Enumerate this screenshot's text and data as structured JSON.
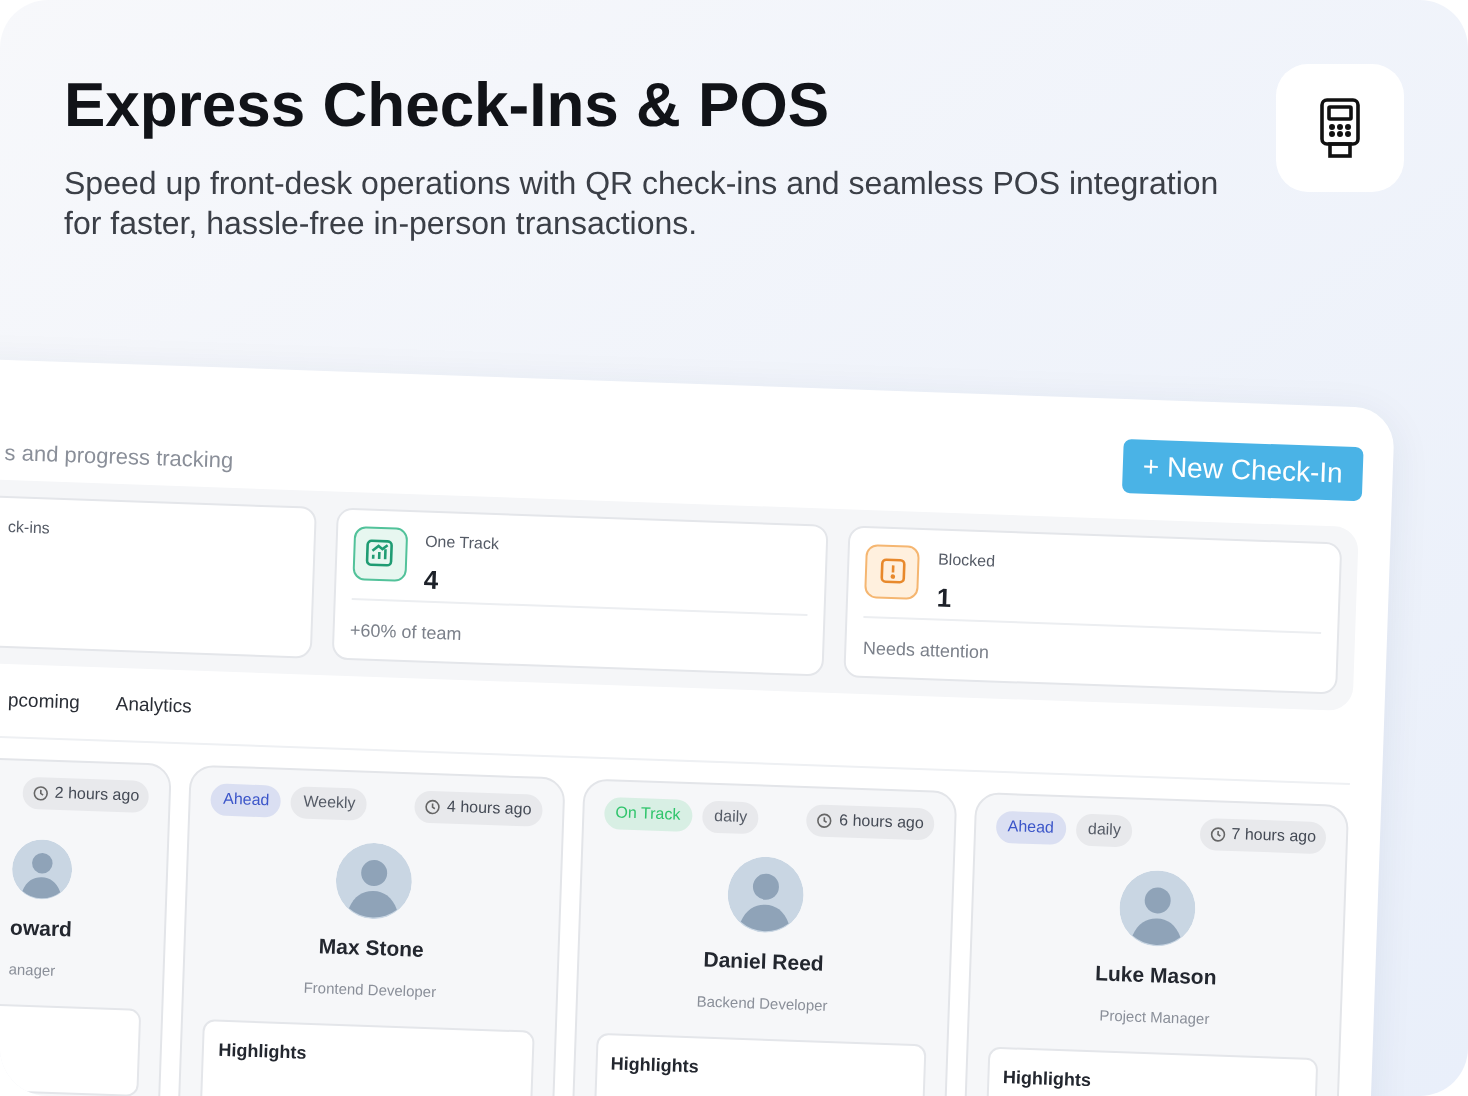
{
  "header": {
    "title": "Express Check-Ins & POS",
    "description": "Speed up front-desk operations with QR check-ins and seamless POS integration for faster, hassle-free in-person transactions."
  },
  "dashboard": {
    "subtitle": "s and progress tracking",
    "new_button": "+ New Check-In",
    "stats": [
      {
        "kind": "partial",
        "label": "ck-ins"
      },
      {
        "kind": "trend",
        "label": "One Track",
        "value": "4",
        "footer": "+60% of team"
      },
      {
        "kind": "warning",
        "label": "Blocked",
        "value": "1",
        "footer": "Needs attention"
      }
    ],
    "tabs": [
      {
        "label": "pcoming"
      },
      {
        "label": "Analytics"
      }
    ],
    "checkins": [
      {
        "kind": "partial",
        "time": "2 hours ago",
        "name": "oward",
        "role": "anager"
      },
      {
        "kind": "full",
        "status": "Ahead",
        "color": "#3b55c9",
        "frequency": "Weekly",
        "time": "4 hours ago",
        "name": "Max Stone",
        "role": "Frontend Developer",
        "highlights": "Highlights"
      },
      {
        "kind": "full",
        "status": "On Track",
        "color": "#2fc46b",
        "frequency": "daily",
        "time": "6 hours ago",
        "name": "Daniel Reed",
        "role": "Backend Developer",
        "highlights": "Highlights"
      },
      {
        "kind": "full",
        "status": "Ahead",
        "color": "#3b55c9",
        "frequency": "daily",
        "time": "7 hours ago",
        "name": "Luke Mason",
        "role": "Project Manager",
        "highlights": "Highlights"
      }
    ]
  }
}
